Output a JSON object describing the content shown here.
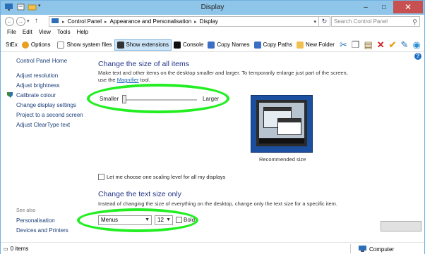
{
  "window": {
    "title": "Display",
    "controls": {
      "minimize": "–",
      "maximize": "□",
      "close": "✕"
    }
  },
  "address": {
    "breadcrumbs": [
      "Control Panel",
      "Appearance and Personalisation",
      "Display"
    ],
    "search_placeholder": "Search Control Panel"
  },
  "menubar": [
    "File",
    "Edit",
    "View",
    "Tools",
    "Help"
  ],
  "toolbar": {
    "stex": "StEx",
    "items": [
      {
        "label": "Options",
        "icon": "gear-icon"
      },
      {
        "label": "Show system files",
        "icon": "file-icon"
      },
      {
        "label": "Show extensions",
        "icon": "extension-icon",
        "active": true
      },
      {
        "label": "Console",
        "icon": "console-icon"
      },
      {
        "label": "Copy Names",
        "icon": "copy-names-icon"
      },
      {
        "label": "Copy Paths",
        "icon": "copy-paths-icon"
      },
      {
        "label": "New Folder",
        "icon": "folder-icon"
      }
    ],
    "action_icons": [
      "cut-icon",
      "copy-icon",
      "paste-icon",
      "delete-icon",
      "checkmark-icon",
      "edit-icon",
      "explorer-icon"
    ]
  },
  "leftpane": {
    "home": "Control Panel Home",
    "links": [
      "Adjust resolution",
      "Adjust brightness",
      "Calibrate colour",
      "Change display settings",
      "Project to a second screen",
      "Adjust ClearType text"
    ],
    "see_also_heading": "See also",
    "see_also": [
      "Personalisation",
      "Devices and Printers"
    ]
  },
  "main": {
    "size_heading": "Change the size of all items",
    "size_desc_1": "Make text and other items on the desktop smaller and larger. To temporarily enlarge just part of the screen,",
    "size_desc_2_pre": "use the ",
    "size_desc_2_link": "Magnifier",
    "size_desc_2_post": " tool.",
    "slider_min": "Smaller",
    "slider_max": "Larger",
    "slider_level": 0.0,
    "preview_label": "Recommended size",
    "one_scaling_label": "Let me choose one scaling level for all my displays",
    "one_scaling_checked": false,
    "text_heading": "Change the text size only",
    "text_desc": "Instead of changing the size of everything on the desktop, change only the text size for a specific item.",
    "item_select": "Menus",
    "size_select": "12",
    "bold_label": "Bold",
    "bold_checked": false
  },
  "status": {
    "items": "0 items",
    "location": "Computer"
  },
  "colors": {
    "titlebar": "#8ec5e8",
    "heading": "#1e3287",
    "link": "#1a3e78",
    "highlight": "#22ee22",
    "close": "#c75050"
  }
}
